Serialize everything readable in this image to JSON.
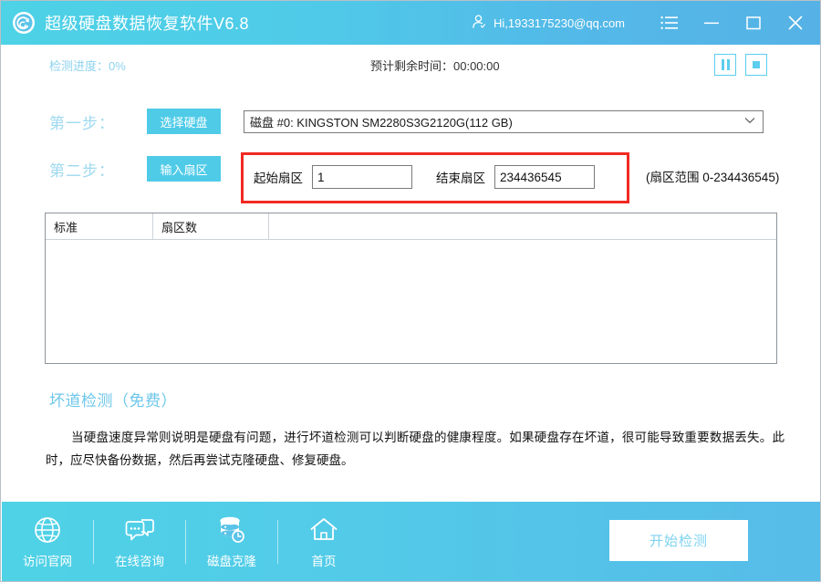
{
  "window": {
    "app_title": "超级硬盘数据恢复软件V6.8",
    "logo_icon": "disk-recovery-logo-icon",
    "user_greeting": "Hi,1933175230@qq.com",
    "user_icon": "user-account-icon",
    "menu_icon": "menu-list-icon",
    "minimize_icon": "minimize-icon",
    "maximize_icon": "maximize-icon",
    "close_icon": "close-icon"
  },
  "status_bar": {
    "progress_label": "检测进度：0%",
    "progress_percent": 0,
    "remaining_label": "预计剩余时间：00:00:00",
    "remaining_time": "00:00:00",
    "pause_icon": "pause-icon",
    "stop_icon": "stop-icon"
  },
  "steps": {
    "step_one": {
      "label": "第一步：",
      "button": "选择硬盘",
      "disk_value": "磁盘 #0: KINGSTON SM2280S3G2120G(112 GB)",
      "chevron_icon": "chevron-down-icon"
    },
    "step_two": {
      "label": "第二步：",
      "button": "输入扇区",
      "start_label": "起始扇区",
      "start_value": "1",
      "end_label": "结束扇区",
      "end_value": "234436545",
      "range_note": "(扇区范围 0-234436545)",
      "highlight_color": "#f12a22"
    }
  },
  "table": {
    "columns": [
      "标准",
      "扇区数",
      ""
    ],
    "rows": []
  },
  "info": {
    "title": "坏道检测（免费）",
    "body": "当硬盘速度异常则说明是硬盘有问题，进行坏道检测可以判断硬盘的健康程度。如果硬盘存在坏道，很可能导致重要数据丢失。此时，应尽快备份数据，然后再尝试克隆硬盘、修复硬盘。"
  },
  "footer": {
    "items": [
      {
        "label": "访问官网",
        "icon": "globe-icon"
      },
      {
        "label": "在线咨询",
        "icon": "chat-bubble-icon"
      },
      {
        "label": "磁盘克隆",
        "icon": "database-clone-icon"
      },
      {
        "label": "首页",
        "icon": "home-icon"
      }
    ],
    "start_button": "开始检测"
  },
  "colors": {
    "brand_cyan": "#4fcbe8",
    "brand_blue": "#56b2e6",
    "accent_light": "#9fd9f0",
    "alert_red": "#f12a22"
  }
}
